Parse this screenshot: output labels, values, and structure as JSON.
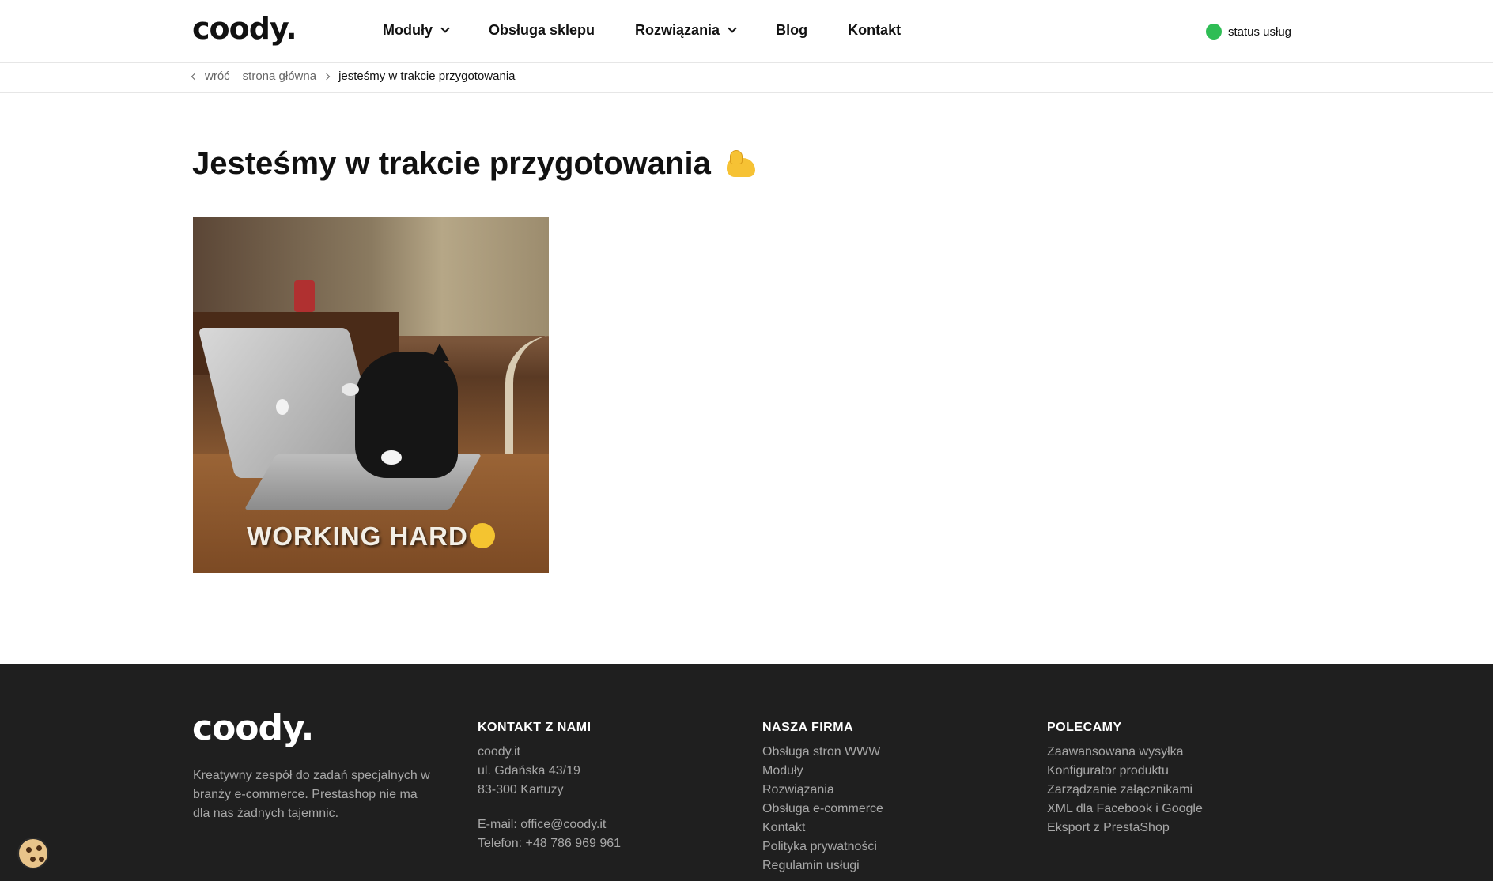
{
  "header": {
    "logo": "coody.",
    "nav": [
      {
        "label": "Moduły",
        "dropdown": true
      },
      {
        "label": "Obsługa sklepu",
        "dropdown": false
      },
      {
        "label": "Rozwiązania",
        "dropdown": true
      },
      {
        "label": "Blog",
        "dropdown": false
      },
      {
        "label": "Kontakt",
        "dropdown": false
      }
    ],
    "status_label": "status usług",
    "status_color": "#2fbd55"
  },
  "breadcrumb": {
    "back": "wróć",
    "home": "strona główna",
    "current": "jesteśmy w trakcie przygotowania"
  },
  "main": {
    "title": "Jesteśmy w trakcie przygotowania",
    "title_icon": "flexed-biceps-icon",
    "gif_caption": "WORKING HARD"
  },
  "footer": {
    "logo": "coody.",
    "about": "Kreatywny zespół do zadań specjalnych w branży e-commerce. Prestashop nie ma dla nas żadnych tajemnic.",
    "contact": {
      "heading": "KONTAKT Z NAMI",
      "address": [
        "coody.it",
        "ul. Gdańska 43/19",
        "83-300 Kartuzy"
      ],
      "email": "E-mail: office@coody.it",
      "phone": "Telefon: +48 786 969 961"
    },
    "company": {
      "heading": "NASZA FIRMA",
      "links": [
        "Obsługa stron WWW",
        "Moduły",
        "Rozwiązania",
        "Obsługa e-commerce",
        "Kontakt",
        "Polityka prywatności",
        "Regulamin usługi"
      ]
    },
    "recommend": {
      "heading": "POLECAMY",
      "links": [
        "Zaawansowana wysyłka",
        "Konfigurator produktu",
        "Zarządzanie załącznikami",
        "XML dla Facebook i Google",
        "Eksport z PrestaShop"
      ]
    }
  },
  "cookie_icon": "cookie-icon"
}
